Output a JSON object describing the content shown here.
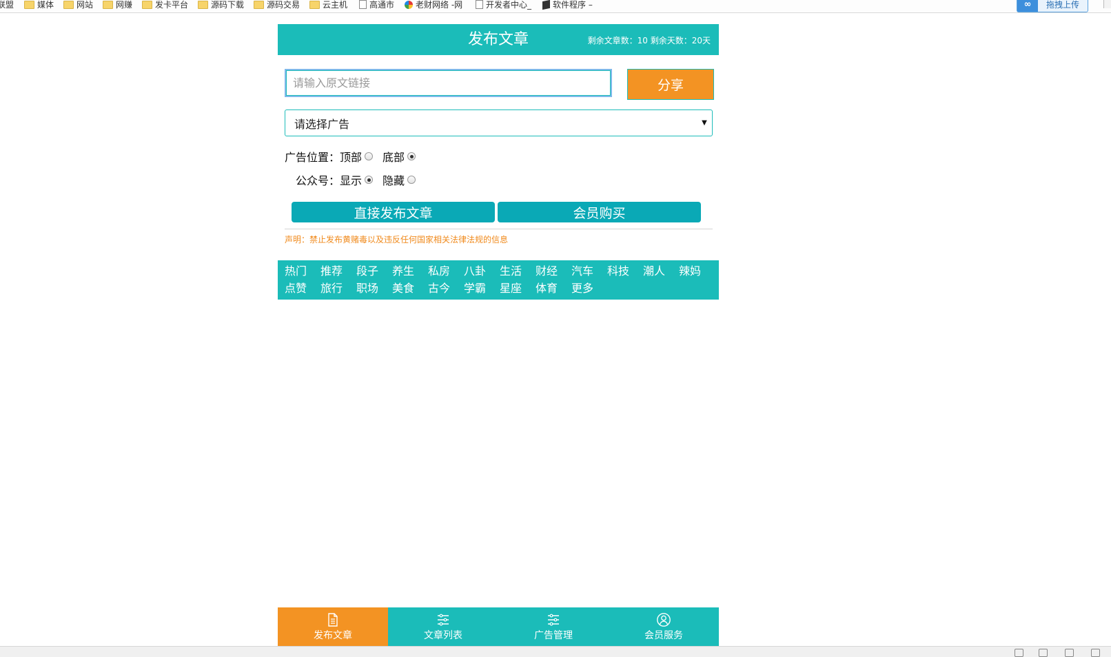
{
  "browser": {
    "bookmarks": [
      {
        "label": "联盟",
        "icon": "folder-icon"
      },
      {
        "label": "媒体",
        "icon": "folder-icon"
      },
      {
        "label": "网站",
        "icon": "folder-icon"
      },
      {
        "label": "网赚",
        "icon": "folder-icon"
      },
      {
        "label": "发卡平台",
        "icon": "folder-icon"
      },
      {
        "label": "源码下载",
        "icon": "folder-icon"
      },
      {
        "label": "源码交易",
        "icon": "folder-icon"
      },
      {
        "label": "云主机",
        "icon": "folder-icon"
      },
      {
        "label": "高通市",
        "icon": "page-icon"
      },
      {
        "label": "老财网络 -网",
        "icon": "site-logo-icon"
      },
      {
        "label": "开发者中心_",
        "icon": "page-icon"
      },
      {
        "label": "软件程序 –",
        "icon": "box-logo-icon"
      }
    ],
    "upload_button": "拖拽上传"
  },
  "header": {
    "title": "发布文章",
    "quota": "剩余文章数：10 剩余天数：20天"
  },
  "form": {
    "url_placeholder": "请输入原文链接",
    "share_label": "分享",
    "ad_select_value": "请选择广告",
    "ad_position": {
      "label": "广告位置：",
      "options": [
        {
          "label": "顶部",
          "checked": false
        },
        {
          "label": "底部",
          "checked": true
        }
      ]
    },
    "official_account": {
      "label": "公众号：",
      "options": [
        {
          "label": "显示",
          "checked": true
        },
        {
          "label": "隐藏",
          "checked": false
        }
      ]
    },
    "publish_label": "直接发布文章",
    "member_buy_label": "会员购买",
    "notice": "声明：禁止发布黄赌毒以及违反任何国家相关法律法规的信息"
  },
  "categories": [
    "热门",
    "推荐",
    "段子",
    "养生",
    "私房",
    "八卦",
    "生活",
    "财经",
    "汽车",
    "科技",
    "潮人",
    "辣妈",
    "点赞",
    "旅行",
    "职场",
    "美食",
    "古今",
    "学霸",
    "星座",
    "体育",
    "更多"
  ],
  "tabbar": [
    {
      "label": "发布文章",
      "icon": "document-icon",
      "active": true
    },
    {
      "label": "文章列表",
      "icon": "list-icon",
      "active": false
    },
    {
      "label": "广告管理",
      "icon": "list-icon",
      "active": false
    },
    {
      "label": "会员服务",
      "icon": "user-icon",
      "active": false
    }
  ],
  "colors": {
    "primary": "#1bbcb9",
    "button": "#0aa9b6",
    "accent": "#f39323",
    "notice": "#f08a1c"
  }
}
